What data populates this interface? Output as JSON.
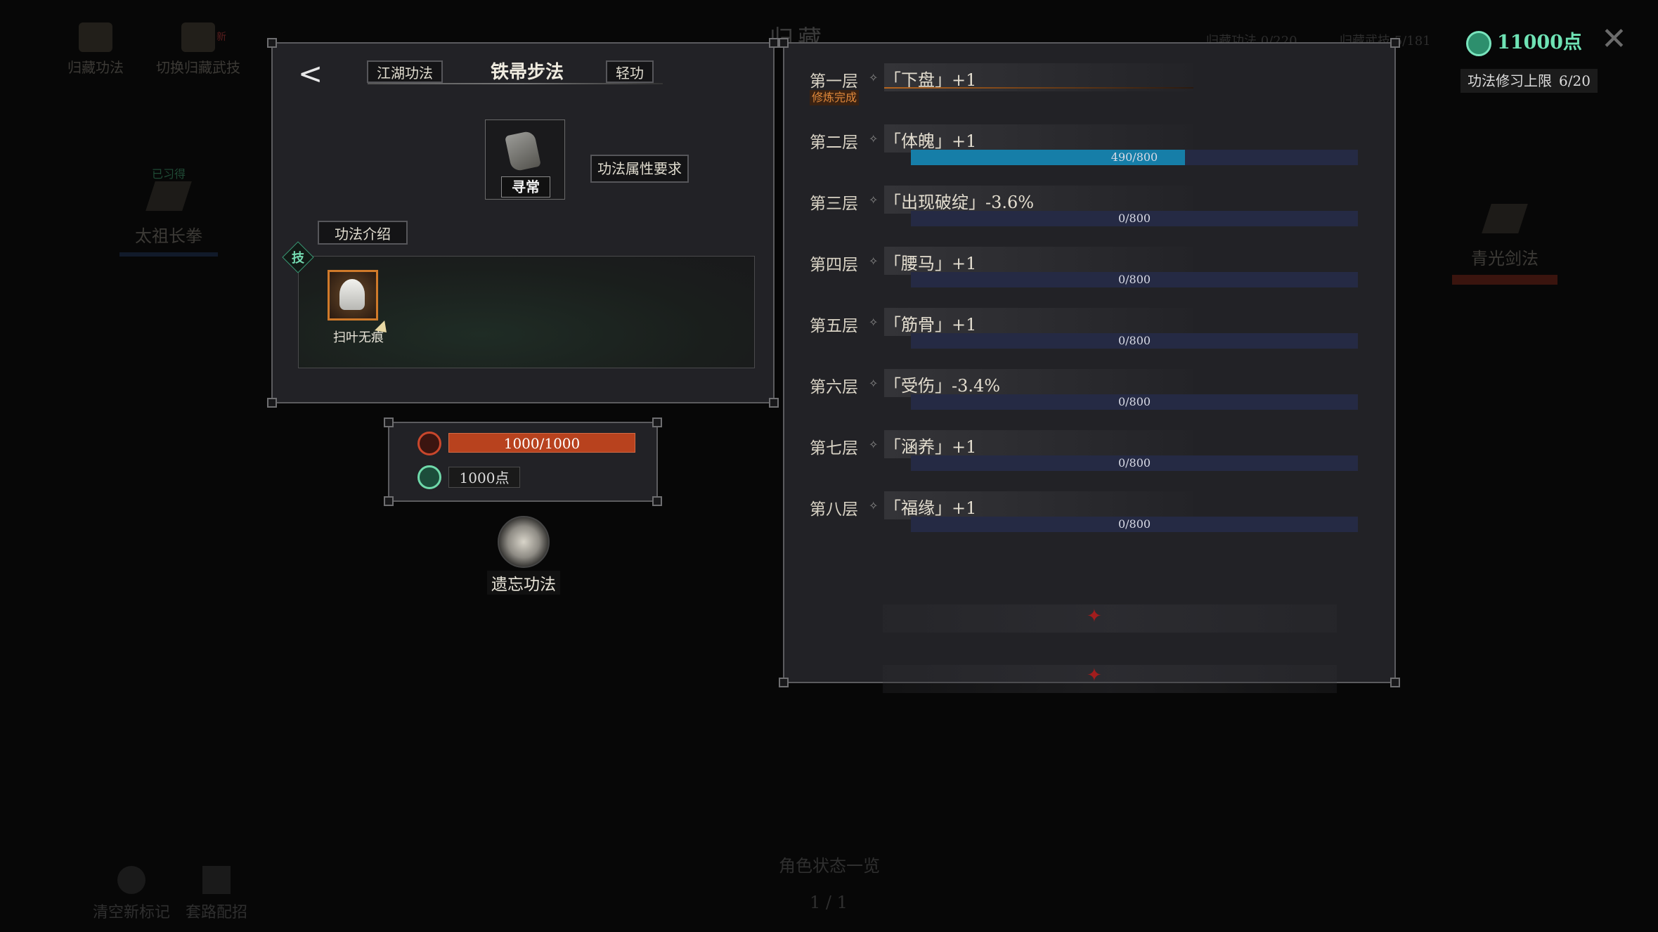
{
  "background": {
    "toolbar": [
      {
        "label": "归藏功法",
        "badge": ""
      },
      {
        "label": "切换归藏武技",
        "badge": "新"
      }
    ],
    "title": "归藏",
    "stats": [
      "归藏功法 0/220",
      "归藏武技 5/181"
    ],
    "left_card": {
      "status": "已习得",
      "name": "太祖长拳"
    },
    "right_card": {
      "name": "青光剑法"
    },
    "bottom_buttons": [
      "清空新标记",
      "套路配招"
    ],
    "bottom_title": "角色状态一览",
    "page": "1 / 1"
  },
  "currency": {
    "points": "11000点",
    "cap_label": "功法修习上限",
    "cap_value": "6/20"
  },
  "left_panel": {
    "tabs": [
      "江湖功法",
      "铁帚步法",
      "轻功"
    ],
    "rarity": "寻常",
    "requirement_button": "功法属性要求",
    "intro_button": "功法介绍",
    "skill_tag": "技",
    "skill_name": "扫叶无痕"
  },
  "stat_panel": {
    "hp": "1000/1000",
    "points": "1000点"
  },
  "forget_button": "遗忘功法",
  "tiers": [
    {
      "name": "第一层",
      "effect": "「下盘」+1",
      "status": "修炼完成",
      "progress": null,
      "progress_text": ""
    },
    {
      "name": "第二层",
      "effect": "「体魄」+1",
      "status": "",
      "progress": 0.6125,
      "progress_text": "490/800"
    },
    {
      "name": "第三层",
      "effect": "「出现破绽」-3.6%",
      "status": "",
      "progress": 0,
      "progress_text": "0/800"
    },
    {
      "name": "第四层",
      "effect": "「腰马」+1",
      "status": "",
      "progress": 0,
      "progress_text": "0/800"
    },
    {
      "name": "第五层",
      "effect": "「筋骨」+1",
      "status": "",
      "progress": 0,
      "progress_text": "0/800"
    },
    {
      "name": "第六层",
      "effect": "「受伤」-3.4%",
      "status": "",
      "progress": 0,
      "progress_text": "0/800"
    },
    {
      "name": "第七层",
      "effect": "「涵养」+1",
      "status": "",
      "progress": 0,
      "progress_text": "0/800"
    },
    {
      "name": "第八层",
      "effect": "「福缘」+1",
      "status": "",
      "progress": 0,
      "progress_text": "0/800"
    }
  ],
  "colors": {
    "accent_green": "#6fe3b5",
    "progress_blue": "#167ea8",
    "hp_red": "#b8421e",
    "complete_orange": "#e0883a"
  }
}
